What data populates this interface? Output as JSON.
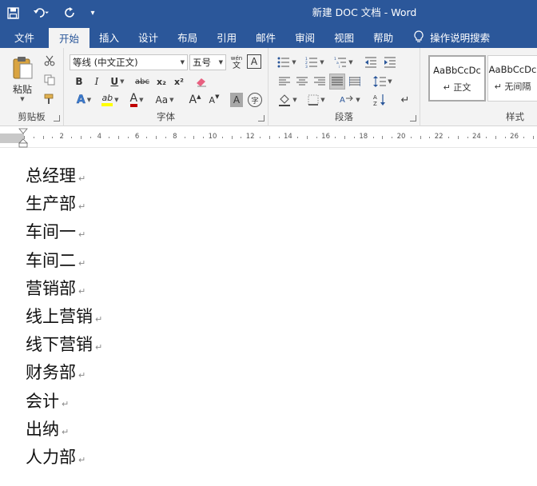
{
  "window": {
    "title": "新建 DOC 文档  -  Word"
  },
  "quick_access": {
    "customize_icon": "▾"
  },
  "tabs": [
    {
      "label": "文件"
    },
    {
      "label": "开始"
    },
    {
      "label": "插入"
    },
    {
      "label": "设计"
    },
    {
      "label": "布局"
    },
    {
      "label": "引用"
    },
    {
      "label": "邮件"
    },
    {
      "label": "审阅"
    },
    {
      "label": "视图"
    },
    {
      "label": "帮助"
    },
    {
      "label": "操作说明搜索"
    }
  ],
  "ribbon": {
    "clipboard": {
      "label": "剪贴板",
      "paste_label": "粘贴"
    },
    "font": {
      "label": "字体",
      "font_name": "等线 (中文正文)",
      "font_size": "五号",
      "bold": "B",
      "italic": "I",
      "underline": "U",
      "strikethrough": "abc",
      "subscript": "x₂",
      "superscript": "x²",
      "text_effects": "A",
      "highlight": "ab",
      "font_color": "A",
      "change_case": "Aa",
      "grow_font": "A",
      "shrink_font": "A",
      "char_shading": "A",
      "enclose": "字",
      "phonetic_top": "wén",
      "phonetic_bottom": "文",
      "char_border": "A",
      "highlight_color": "#ffff00",
      "font_color_value": "#c00000"
    },
    "paragraph": {
      "label": "段落"
    },
    "styles": {
      "label": "样式",
      "items": [
        {
          "sample": "AaBbCcDc",
          "name": "↵ 正文"
        },
        {
          "sample": "AaBbCcDc",
          "name": "↵ 无间隔"
        }
      ]
    }
  },
  "ruler": {
    "labels": [
      "2",
      "4",
      "6",
      "8",
      "10",
      "12",
      "14",
      "16",
      "18",
      "20",
      "22",
      "24",
      "26"
    ]
  },
  "document": {
    "paragraphs": [
      "总经理",
      "生产部",
      "车间一",
      "车间二",
      "营销部",
      "线上营销",
      "线下营销",
      "财务部",
      "会计",
      "出纳",
      "人力部"
    ],
    "paragraph_mark": "↵"
  }
}
